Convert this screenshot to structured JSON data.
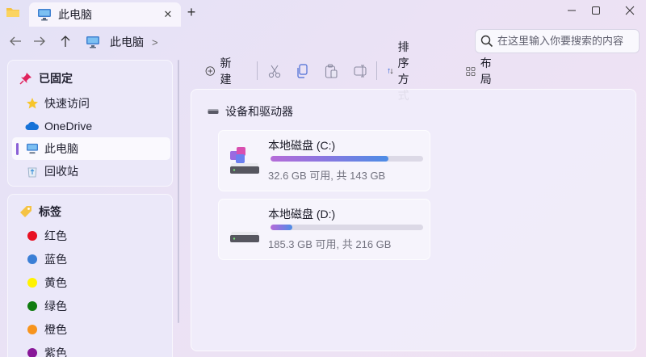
{
  "titlebar": {
    "tab_label": "此电脑",
    "tab_close": "✕",
    "new_tab": "+"
  },
  "address": {
    "crumb": "此电脑",
    "separator": ">",
    "search_placeholder": "在这里输入你要搜索的内容"
  },
  "sidebar": {
    "pinned_header": "已固定",
    "pinned_items": [
      {
        "label": "快速访问",
        "icon": "star-icon"
      },
      {
        "label": "OneDrive",
        "icon": "onedrive-cloud-icon"
      },
      {
        "label": "此电脑",
        "icon": "computer-icon",
        "selected": true
      },
      {
        "label": "回收站",
        "icon": "recycle-bin-icon"
      }
    ],
    "tags_header": "标签",
    "tags": [
      {
        "label": "红色",
        "color": "#e81123"
      },
      {
        "label": "蓝色",
        "color": "#3b7fd6"
      },
      {
        "label": "黄色",
        "color": "#fff200"
      },
      {
        "label": "绿色",
        "color": "#107c10"
      },
      {
        "label": "橙色",
        "color": "#f7941d"
      },
      {
        "label": "紫色",
        "color": "#881798"
      }
    ]
  },
  "toolbar": {
    "new_label": "新建",
    "sort_label": "排序方式",
    "layout_label": "布局"
  },
  "main": {
    "section_title": "设备和驱动器",
    "drives": [
      {
        "name": "本地磁盘 (C:)",
        "space": "32.6 GB 可用, 共 143 GB",
        "used_fraction": 0.772
      },
      {
        "name": "本地磁盘 (D:)",
        "space": "185.3 GB 可用, 共 216 GB",
        "used_fraction": 0.142
      }
    ]
  },
  "colors": {
    "accent": "#8a60d6",
    "progress_start": "#b56bd8",
    "progress_end": "#4c8de6"
  }
}
